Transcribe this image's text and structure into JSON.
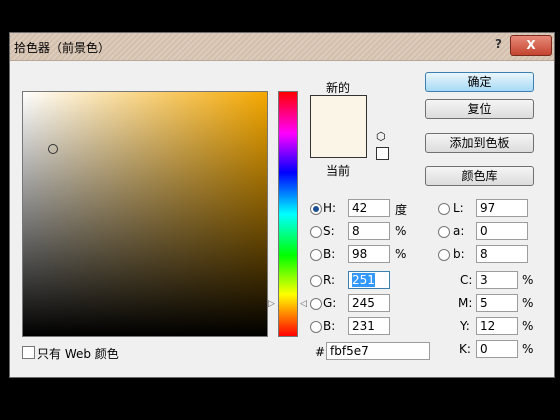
{
  "dialog": {
    "title": "拾色器（前景色）",
    "help_label": "?",
    "close_label": "X"
  },
  "preview": {
    "new_label": "新的",
    "current_label": "当前",
    "new_color": "#fbf5e7"
  },
  "buttons": {
    "ok": "确定",
    "reset": "复位",
    "add_swatch": "添加到色板",
    "libraries": "颜色库"
  },
  "hsb": {
    "h_label": "H:",
    "h_value": "42",
    "h_unit": "度",
    "s_label": "S:",
    "s_value": "8",
    "s_unit": "%",
    "b_label": "B:",
    "b_value": "98",
    "b_unit": "%"
  },
  "rgb": {
    "r_label": "R:",
    "r_value": "251",
    "g_label": "G:",
    "g_value": "245",
    "b_label": "B:",
    "b_value": "231"
  },
  "lab": {
    "l_label": "L:",
    "l_value": "97",
    "a_label": "a:",
    "a_value": "0",
    "b_label": "b:",
    "b_value": "8"
  },
  "cmyk": {
    "c_label": "C:",
    "c_value": "3",
    "c_unit": "%",
    "m_label": "M:",
    "m_value": "5",
    "m_unit": "%",
    "y_label": "Y:",
    "y_value": "12",
    "y_unit": "%",
    "k_label": "K:",
    "k_value": "0",
    "k_unit": "%"
  },
  "hex": {
    "label": "#",
    "value": "fbf5e7"
  },
  "websafe": {
    "label": "只有 Web 颜色"
  },
  "icons": {
    "cube": "⬡",
    "arrow_left": "▷",
    "arrow_right": "◁"
  }
}
